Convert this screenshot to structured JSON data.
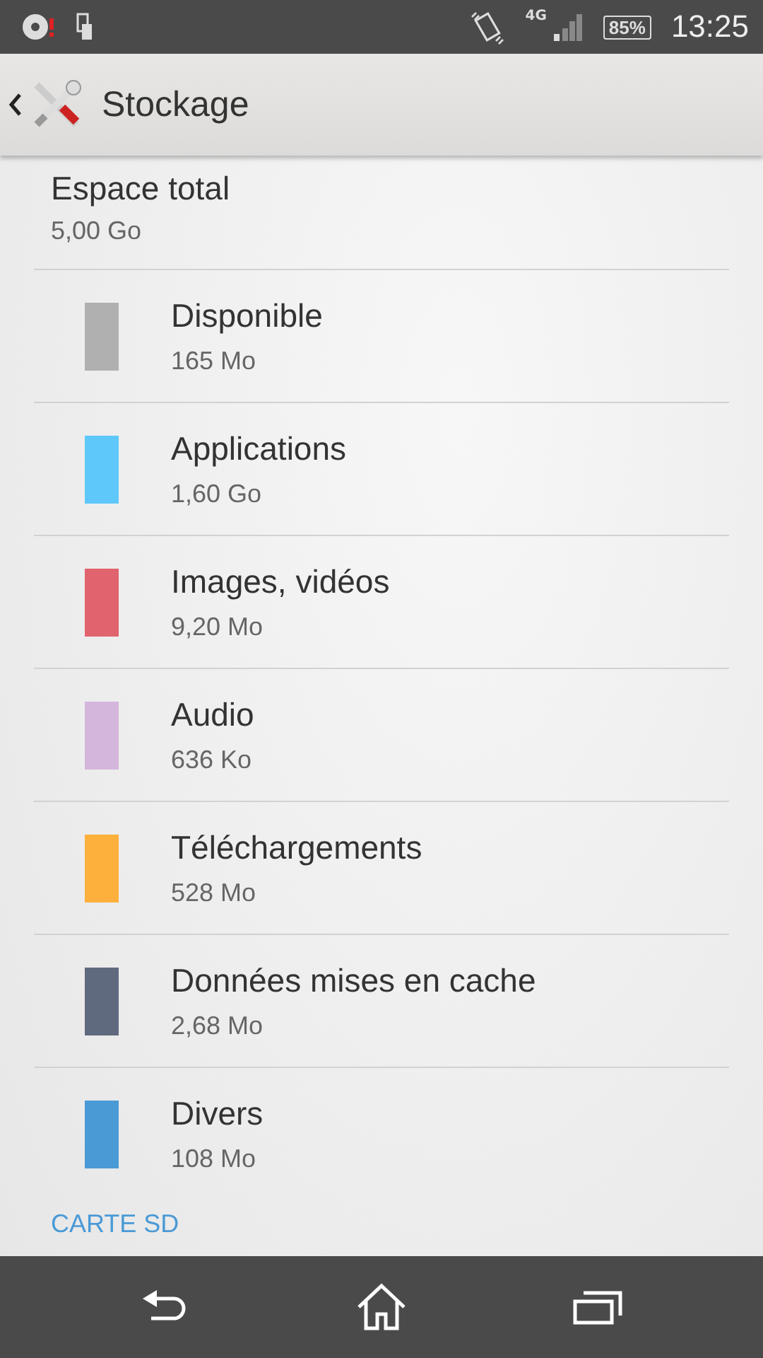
{
  "status_bar": {
    "network": "4G",
    "battery": "85%",
    "time": "13:25"
  },
  "action_bar": {
    "title": "Stockage"
  },
  "total": {
    "label": "Espace total",
    "value": "5,00 Go"
  },
  "categories": [
    {
      "name": "Disponible",
      "size": "165 Mo",
      "color": "#b0b0b0"
    },
    {
      "name": "Applications",
      "size": "1,60 Go",
      "color": "#5ec8fa"
    },
    {
      "name": "Images, vidéos",
      "size": "9,20 Mo",
      "color": "#e0636d"
    },
    {
      "name": "Audio",
      "size": "636 Ko",
      "color": "#d4b5dc"
    },
    {
      "name": "Téléchargements",
      "size": "528 Mo",
      "color": "#fdb03c"
    },
    {
      "name": "Données mises en cache",
      "size": "2,68 Mo",
      "color": "#5f6a7e"
    },
    {
      "name": "Divers",
      "size": "108 Mo",
      "color": "#4a9ad6"
    }
  ],
  "section_header": "CARTE SD"
}
